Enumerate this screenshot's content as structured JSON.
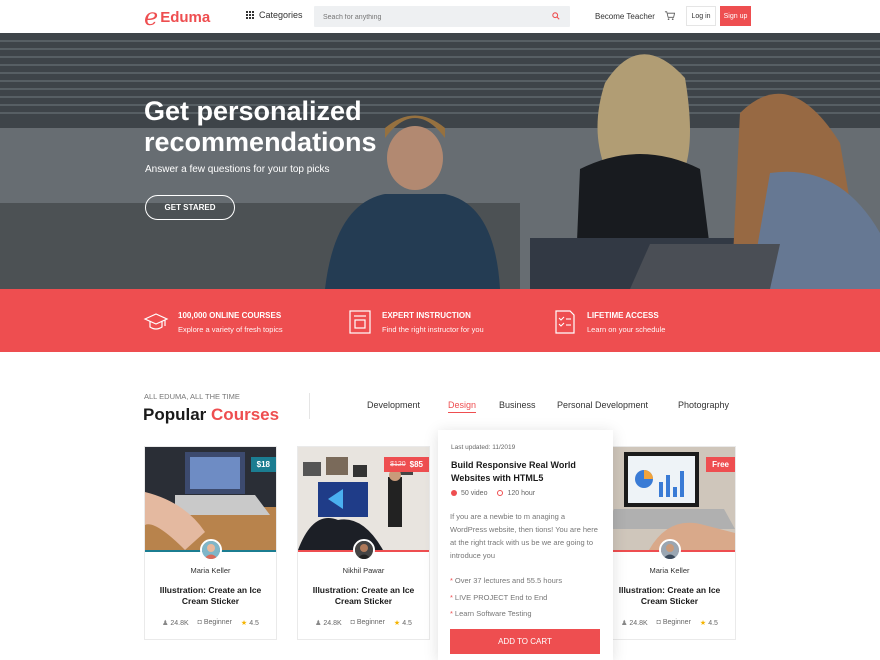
{
  "header": {
    "logo_mark": "e",
    "logo_text": "Eduma",
    "categories_label": "Categories",
    "search_placeholder": "Seach for anything",
    "become_teacher": "Become Teacher",
    "login": "Log in",
    "signup": "Sign up"
  },
  "hero": {
    "title": "Get personalized recommendations",
    "subtitle": "Answer a few questions for your top picks",
    "button": "GET STARED"
  },
  "features": [
    {
      "icon": "graduation-cap-icon",
      "title": "100,000 ONLINE COURSES",
      "desc": "Explore a variety of fresh topics"
    },
    {
      "icon": "certificate-icon",
      "title": "EXPERT INSTRUCTION",
      "desc": "Find the right instructor for you"
    },
    {
      "icon": "checklist-icon",
      "title": "LIFETIME ACCESS",
      "desc": "Learn on your schedule"
    }
  ],
  "section": {
    "small": "ALL EDUMA, ALL THE TIME",
    "title_main": "Popular",
    "title_accent": "Courses",
    "tabs": [
      "Development",
      "Design",
      "Business",
      "Personal Development",
      "Photography"
    ],
    "active_tab": "Design"
  },
  "courses": [
    {
      "price": "$18",
      "old_price": "",
      "price_color": "#1b7d91",
      "author": "Maria Keller",
      "title": "Illustration: Create an Ice Cream Sticker",
      "students": "24.8K",
      "level": "Beginner",
      "rating": "4.5"
    },
    {
      "price": "$85",
      "old_price": "$120",
      "price_color": "#ee4e50",
      "author": "Nikhil Pawar",
      "title": "Illustration: Create an Ice Cream Sticker",
      "students": "24.8K",
      "level": "Beginner",
      "rating": "4.5"
    },
    {
      "price": "Free",
      "old_price": "",
      "price_color": "#ee4e50",
      "author": "Maria Keller",
      "title": "Illustration: Create an Ice Cream Sticker",
      "students": "24.8K",
      "level": "Beginner",
      "rating": "4.5"
    }
  ],
  "popup": {
    "updated": "Last updated: 11/2019",
    "title": "Build Responsive Real World Websites with HTML5",
    "videos": "50 video",
    "hours": "120 hour",
    "desc": "If you are a newbie to m anaging a WordPress website, then tions! You are here at the right track with us be we are going to introduce you",
    "bullets": [
      "Over 37 lectures and 55.5 hours",
      "LIVE PROJECT End to End",
      "Learn Software Testing"
    ],
    "cart": "ADD TO CART"
  },
  "colors": {
    "accent": "#ee4e50",
    "teal": "#1b7d91"
  }
}
